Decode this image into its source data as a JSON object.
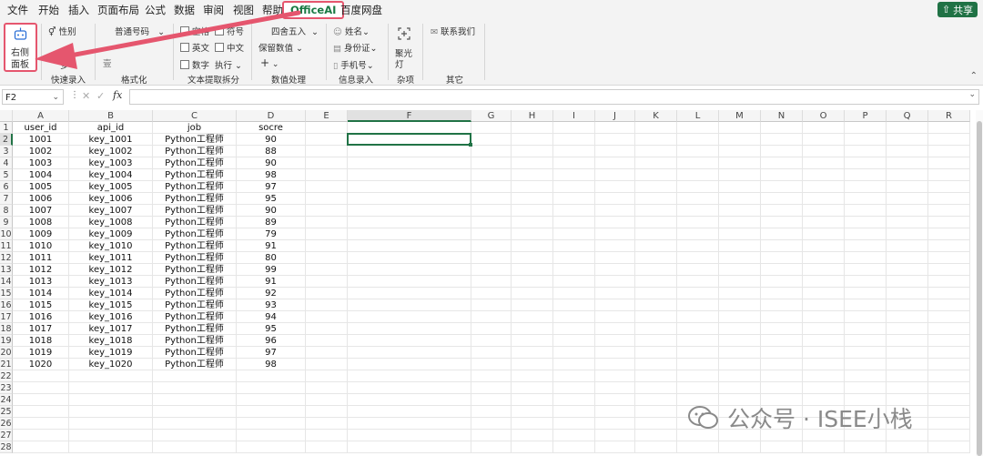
{
  "menu": {
    "items": [
      "文件",
      "开始",
      "插入",
      "页面布局",
      "公式",
      "数据",
      "审阅",
      "视图",
      "帮助",
      "OfficeAI",
      "百度网盘"
    ],
    "active": "OfficeAI",
    "share": "共享"
  },
  "ribbon": {
    "right_panel": {
      "line1": "右侧",
      "line2": "面板"
    },
    "quick": {
      "gender": "性别",
      "more": "多",
      "label": "快速录入"
    },
    "format": {
      "number_format": "普通号码",
      "label": "格式化"
    },
    "text": {
      "space": "空格",
      "symbol": "符号",
      "english": "英文",
      "chinese": "中文",
      "digit": "数字",
      "execute": "执行",
      "label": "文本提取拆分"
    },
    "numeric": {
      "round": "四舍五入",
      "keep": "保留数值",
      "label": "数值处理"
    },
    "info": {
      "name": "姓名",
      "id_card": "身份证",
      "phone": "手机号",
      "label": "信息录入"
    },
    "misc": {
      "spotlight_1": "聚光",
      "spotlight_2": "灯",
      "label": "杂项"
    },
    "other": {
      "contact": "联系我们",
      "label": "其它"
    }
  },
  "formula_bar": {
    "cell_ref": "F2",
    "fx": "fx",
    "value": ""
  },
  "sheet": {
    "columns": [
      "A",
      "B",
      "C",
      "D",
      "E",
      "F",
      "G",
      "H",
      "I",
      "J",
      "K",
      "L",
      "M",
      "N",
      "O",
      "P",
      "Q",
      "R"
    ],
    "selected_cell": "F2",
    "headers": [
      "user_id",
      "api_id",
      "job",
      "socre"
    ],
    "rows": [
      [
        "1001",
        "key_1001",
        "Python工程师",
        "90"
      ],
      [
        "1002",
        "key_1002",
        "Python工程师",
        "88"
      ],
      [
        "1003",
        "key_1003",
        "Python工程师",
        "90"
      ],
      [
        "1004",
        "key_1004",
        "Python工程师",
        "98"
      ],
      [
        "1005",
        "key_1005",
        "Python工程师",
        "97"
      ],
      [
        "1006",
        "key_1006",
        "Python工程师",
        "95"
      ],
      [
        "1007",
        "key_1007",
        "Python工程师",
        "90"
      ],
      [
        "1008",
        "key_1008",
        "Python工程师",
        "89"
      ],
      [
        "1009",
        "key_1009",
        "Python工程师",
        "79"
      ],
      [
        "1010",
        "key_1010",
        "Python工程师",
        "91"
      ],
      [
        "1011",
        "key_1011",
        "Python工程师",
        "80"
      ],
      [
        "1012",
        "key_1012",
        "Python工程师",
        "99"
      ],
      [
        "1013",
        "key_1013",
        "Python工程师",
        "91"
      ],
      [
        "1014",
        "key_1014",
        "Python工程师",
        "92"
      ],
      [
        "1015",
        "key_1015",
        "Python工程师",
        "93"
      ],
      [
        "1016",
        "key_1016",
        "Python工程师",
        "94"
      ],
      [
        "1017",
        "key_1017",
        "Python工程师",
        "95"
      ],
      [
        "1018",
        "key_1018",
        "Python工程师",
        "96"
      ],
      [
        "1019",
        "key_1019",
        "Python工程师",
        "97"
      ],
      [
        "1020",
        "key_1020",
        "Python工程师",
        "98"
      ]
    ],
    "row_numbers": [
      "1",
      "2",
      "3",
      "4",
      "5",
      "6",
      "7",
      "8",
      "9",
      "10",
      "11",
      "12",
      "13",
      "14",
      "15",
      "16",
      "17",
      "18",
      "19",
      "20",
      "21",
      "22",
      "23",
      "24",
      "25",
      "26",
      "27",
      "28"
    ]
  },
  "watermark": {
    "text": "公众号 · ISEE小栈"
  },
  "colors": {
    "accent": "#e5566e",
    "share_green": "#207245",
    "select_green": "#217346"
  }
}
